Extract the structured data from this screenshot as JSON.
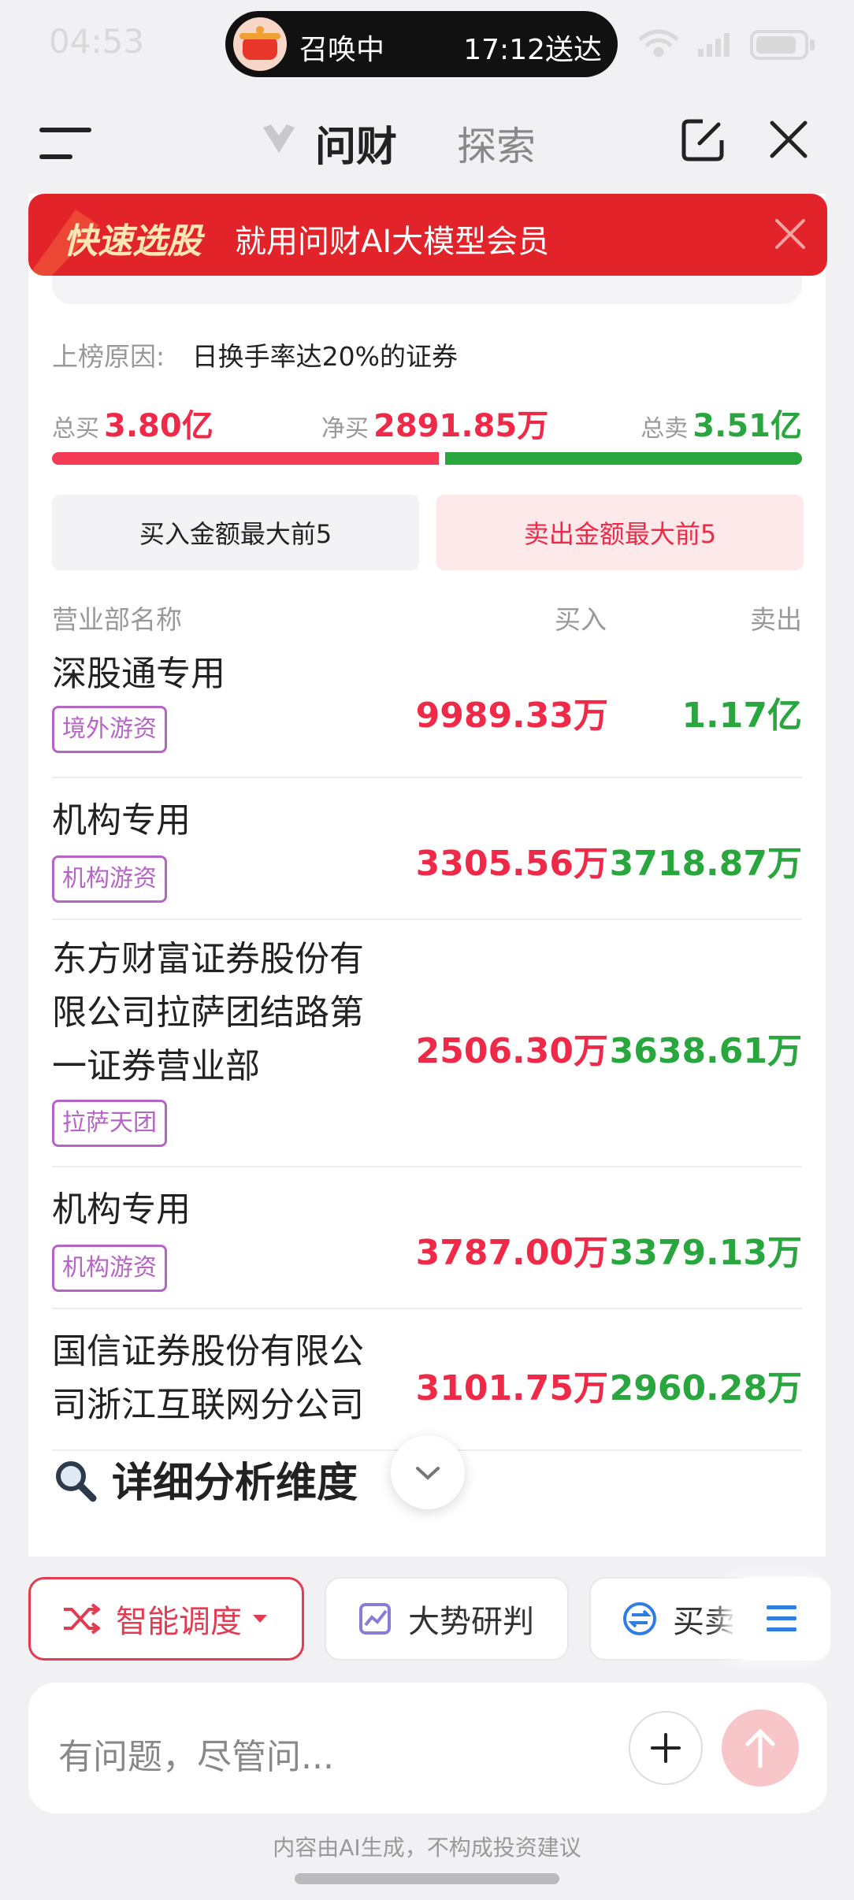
{
  "status": {
    "time": "04:53",
    "pill_left": "召唤中",
    "pill_right": "17:12送达"
  },
  "nav": {
    "tab_active": "问财",
    "tab_inactive": "探索"
  },
  "promo": {
    "title": "快速选股",
    "text": "就用问财AI大模型会员"
  },
  "list_reason": {
    "label": "上榜原因:",
    "value": "日换手率达20%的证券"
  },
  "totals": {
    "buy_label": "总买",
    "buy_value": "3.80亿",
    "net_label": "净买",
    "net_value": "2891.85万",
    "sell_label": "总卖",
    "sell_value": "3.51亿",
    "buy_share": 0.52
  },
  "tabs": {
    "buy_top5": "买入金额最大前5",
    "sell_top5": "卖出金额最大前5"
  },
  "table": {
    "col_name": "营业部名称",
    "col_buy": "买入",
    "col_sell": "卖出",
    "rows": [
      {
        "name": "深股通专用",
        "tag": "境外游资",
        "buy": "9989.33万",
        "sell": "1.17亿"
      },
      {
        "name": "机构专用",
        "tag": "机构游资",
        "buy": "3305.56万",
        "sell": "3718.87万"
      },
      {
        "name": "东方财富证券股份有限公司拉萨团结路第一证券营业部",
        "tag": "拉萨天团",
        "buy": "2506.30万",
        "sell": "3638.61万"
      },
      {
        "name": "机构专用",
        "tag": "机构游资",
        "buy": "3787.00万",
        "sell": "3379.13万"
      },
      {
        "name": "国信证券股份有限公司浙江互联网分公司",
        "tag": "",
        "buy": "3101.75万",
        "sell": "2960.28万"
      }
    ]
  },
  "detail_title": "详细分析维度",
  "chips": {
    "smart": "智能调度",
    "trend": "大势研判",
    "trade": "买卖"
  },
  "input": {
    "placeholder": "有问题，尽管问..."
  },
  "disclaimer": "内容由AI生成，不构成投资建议",
  "colors": {
    "red": "#ee2a48",
    "green": "#2aa63e",
    "tag": "#b764c7",
    "promo_bg": "#e3232a"
  }
}
